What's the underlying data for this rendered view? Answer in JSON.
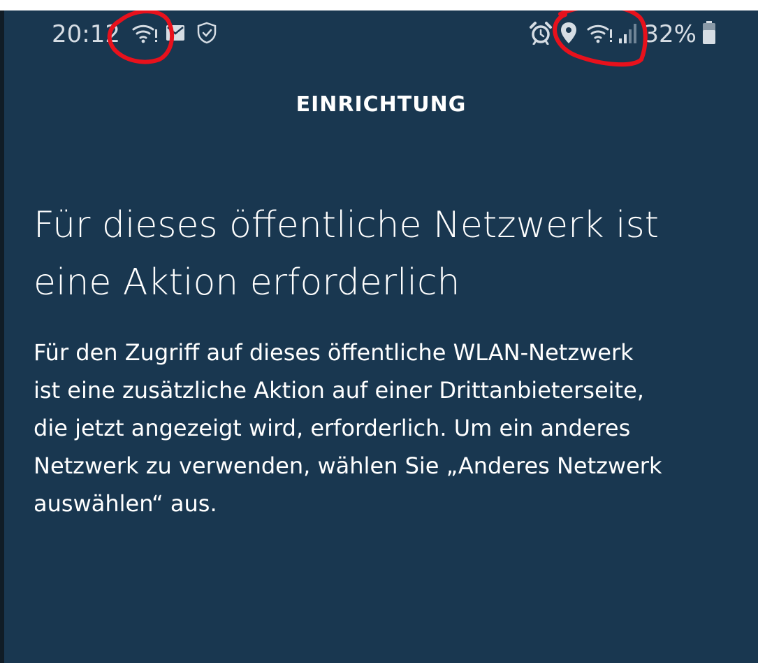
{
  "status_bar": {
    "time": "20:12",
    "battery_percent": "32%",
    "left_icons": [
      "wifi-alert-icon",
      "mail-icon",
      "shield-icon"
    ],
    "right_icons": [
      "alarm-icon",
      "location-icon",
      "wifi-alert-icon",
      "cell-signal-icon",
      "battery-icon"
    ]
  },
  "header": {
    "title": "EINRICHTUNG"
  },
  "main": {
    "headline": "Für dieses öffentliche Netzwerk ist eine Aktion erforderlich",
    "body": "Für den Zugriff auf dieses öffentliche WLAN-Netzwerk ist eine zusätzliche Aktion auf einer Drittanbieterseite, die jetzt angezeigt wird, erforderlich. Um ein anderes Netzwerk zu verwenden, wählen Sie „Anderes Netzwerk auswählen“ aus."
  },
  "colors": {
    "background": "#193750",
    "text": "#ffffff",
    "status_text": "#d6dde4",
    "annotation": "#e8111c"
  }
}
